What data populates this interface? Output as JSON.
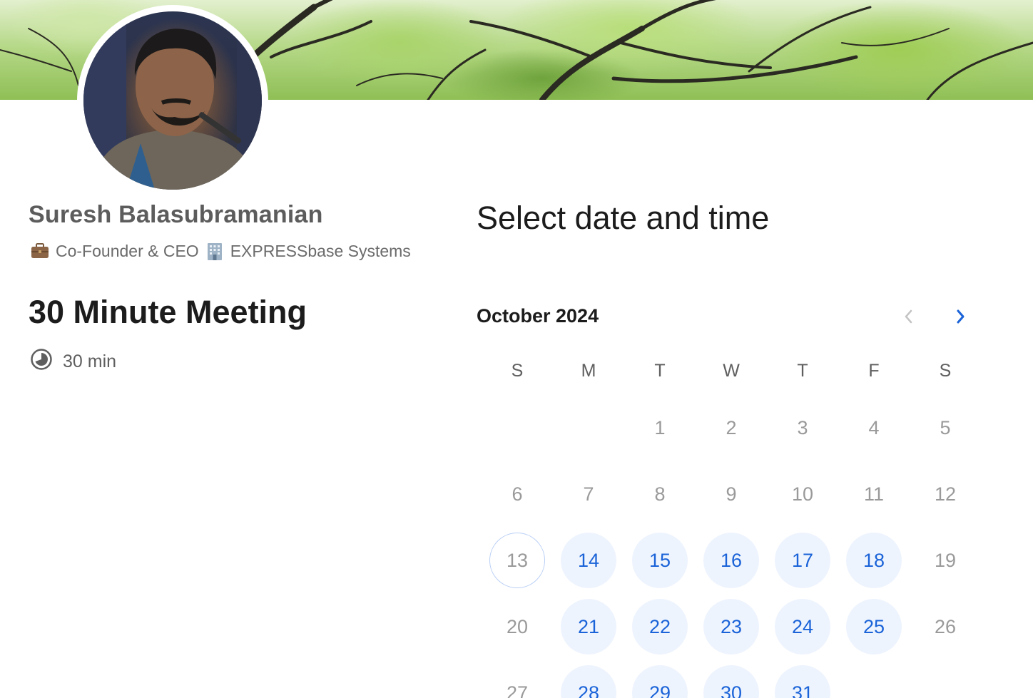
{
  "host": {
    "name": "Suresh Balasubramanian",
    "role": "Co-Founder & CEO",
    "company": "EXPRESSbase Systems",
    "role_icon": "briefcase-icon",
    "company_icon": "building-icon"
  },
  "event": {
    "title": "30 Minute Meeting",
    "duration": "30 min",
    "duration_icon": "clock-icon"
  },
  "scheduler": {
    "title": "Select date and time",
    "month": "October 2024",
    "prev_icon": "chevron-left-icon",
    "next_icon": "chevron-right-icon",
    "weekdays": [
      "S",
      "M",
      "T",
      "W",
      "T",
      "F",
      "S"
    ],
    "days": [
      {
        "d": "1",
        "col": 2,
        "row": 0,
        "state": "disabled"
      },
      {
        "d": "2",
        "col": 3,
        "row": 0,
        "state": "disabled"
      },
      {
        "d": "3",
        "col": 4,
        "row": 0,
        "state": "disabled"
      },
      {
        "d": "4",
        "col": 5,
        "row": 0,
        "state": "disabled"
      },
      {
        "d": "5",
        "col": 6,
        "row": 0,
        "state": "disabled"
      },
      {
        "d": "6",
        "col": 0,
        "row": 1,
        "state": "disabled"
      },
      {
        "d": "7",
        "col": 1,
        "row": 1,
        "state": "disabled"
      },
      {
        "d": "8",
        "col": 2,
        "row": 1,
        "state": "disabled"
      },
      {
        "d": "9",
        "col": 3,
        "row": 1,
        "state": "disabled"
      },
      {
        "d": "10",
        "col": 4,
        "row": 1,
        "state": "disabled"
      },
      {
        "d": "11",
        "col": 5,
        "row": 1,
        "state": "disabled"
      },
      {
        "d": "12",
        "col": 6,
        "row": 1,
        "state": "disabled"
      },
      {
        "d": "13",
        "col": 0,
        "row": 2,
        "state": "today"
      },
      {
        "d": "14",
        "col": 1,
        "row": 2,
        "state": "available"
      },
      {
        "d": "15",
        "col": 2,
        "row": 2,
        "state": "available"
      },
      {
        "d": "16",
        "col": 3,
        "row": 2,
        "state": "available"
      },
      {
        "d": "17",
        "col": 4,
        "row": 2,
        "state": "available"
      },
      {
        "d": "18",
        "col": 5,
        "row": 2,
        "state": "available"
      },
      {
        "d": "19",
        "col": 6,
        "row": 2,
        "state": "disabled"
      },
      {
        "d": "20",
        "col": 0,
        "row": 3,
        "state": "disabled"
      },
      {
        "d": "21",
        "col": 1,
        "row": 3,
        "state": "available"
      },
      {
        "d": "22",
        "col": 2,
        "row": 3,
        "state": "available"
      },
      {
        "d": "23",
        "col": 3,
        "row": 3,
        "state": "available"
      },
      {
        "d": "24",
        "col": 4,
        "row": 3,
        "state": "available"
      },
      {
        "d": "25",
        "col": 5,
        "row": 3,
        "state": "available"
      },
      {
        "d": "26",
        "col": 6,
        "row": 3,
        "state": "disabled"
      },
      {
        "d": "27",
        "col": 0,
        "row": 4,
        "state": "disabled"
      },
      {
        "d": "28",
        "col": 1,
        "row": 4,
        "state": "available"
      },
      {
        "d": "29",
        "col": 2,
        "row": 4,
        "state": "available"
      },
      {
        "d": "30",
        "col": 3,
        "row": 4,
        "state": "available"
      },
      {
        "d": "31",
        "col": 4,
        "row": 4,
        "state": "available"
      }
    ]
  },
  "colors": {
    "accent": "#1a63d8",
    "available_bg": "#eef4fe",
    "muted_text": "#9a9a9a"
  }
}
